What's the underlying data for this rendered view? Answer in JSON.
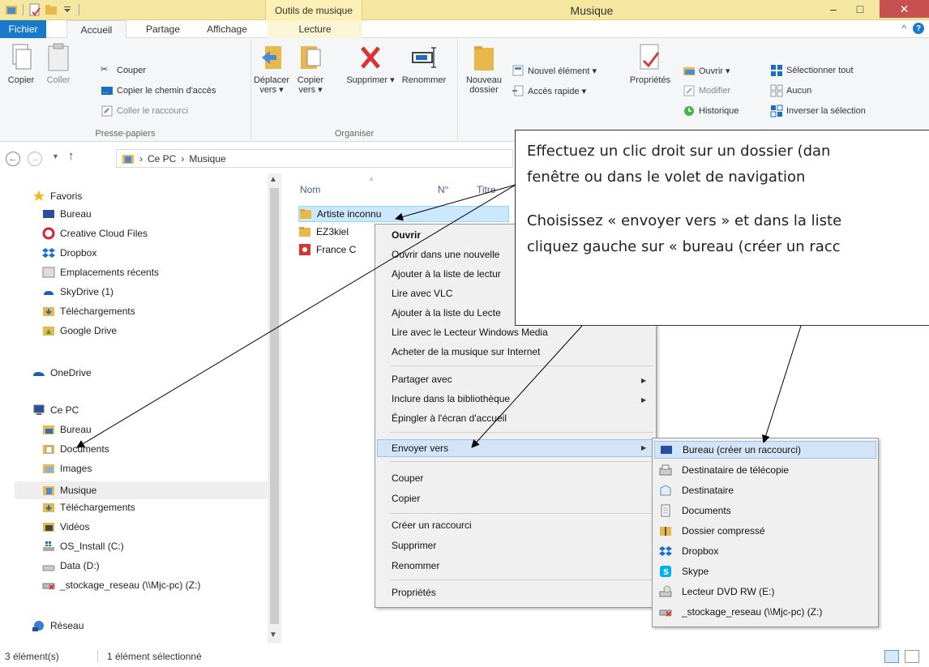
{
  "window": {
    "title": "Musique",
    "contextual_tab_group": "Outils de musique",
    "controls": {
      "minimize": "–",
      "maximize": "□",
      "close": "✕"
    }
  },
  "tabs": {
    "file": "Fichier",
    "home": "Accueil",
    "share": "Partage",
    "view": "Affichage",
    "play": "Lecture"
  },
  "ribbon": {
    "clipboard": {
      "label": "Presse-papiers",
      "copy": "Copier",
      "paste": "Coller",
      "cut": "Couper",
      "copy_path": "Copier le chemin d'accès",
      "paste_shortcut": "Coller le raccourci"
    },
    "organize": {
      "label": "Organiser",
      "move_to": "Déplacer vers ▾",
      "copy_to": "Copier vers ▾",
      "delete": "Supprimer ▾",
      "rename": "Renommer"
    },
    "new": {
      "new_folder": "Nouveau dossier",
      "new_item": "Nouvel élément ▾",
      "easy_access": "Accès rapide ▾"
    },
    "open": {
      "properties": "Propriétés",
      "open": "Ouvrir ▾",
      "edit": "Modifier",
      "history": "Historique"
    },
    "select": {
      "select_all": "Sélectionner tout",
      "select_none": "Aucun",
      "invert": "Inverser la sélection"
    }
  },
  "address": {
    "path": [
      "Ce PC",
      "Musique"
    ],
    "separator": "›"
  },
  "nav": {
    "favorites": "Favoris",
    "favorites_items": [
      "Bureau",
      "Creative Cloud Files",
      "Dropbox",
      "Emplacements récents",
      "SkyDrive (1)",
      "Téléchargements",
      "Google Drive"
    ],
    "onedrive": "OneDrive",
    "thispc": "Ce PC",
    "thispc_items": [
      "Bureau",
      "Documents",
      "Images",
      "Musique",
      "Téléchargements",
      "Vidéos",
      "OS_Install (C:)",
      "Data (D:)",
      "_stockage_reseau (\\\\Mjc-pc) (Z:)"
    ],
    "network": "Réseau"
  },
  "columns": {
    "name": "Nom",
    "number": "N°",
    "title": "Titre"
  },
  "files": [
    "Artiste inconnu",
    "EZ3kiel",
    "France C"
  ],
  "context_menu": {
    "open": "Ouvrir",
    "open_new": "Ouvrir dans une nouvelle",
    "add_playlist": "Ajouter à la liste de lectur",
    "play_vlc": "Lire avec VLC",
    "add_player_list": "Ajouter à la liste du Lecte",
    "play_wmp": "Lire avec le Lecteur Windows Media",
    "buy_music": "Acheter de la musique sur Internet",
    "share_with": "Partager avec",
    "include_library": "Inclure dans la bibliothèque",
    "pin_start": "Épingler à l'écran d'accueil",
    "send_to": "Envoyer vers",
    "cut": "Couper",
    "copy": "Copier",
    "create_shortcut": "Créer un raccourci",
    "delete": "Supprimer",
    "rename": "Renommer",
    "properties": "Propriétés",
    "submenu_arrow": "▶"
  },
  "send_to_menu": {
    "desktop": "Bureau (créer un raccourci)",
    "fax": "Destinataire de télécopie",
    "mail": "Destinataire",
    "documents": "Documents",
    "zip": "Dossier compressé",
    "dropbox": "Dropbox",
    "skype": "Skype",
    "dvd": "Lecteur DVD RW (E:)",
    "network": "_stockage_reseau (\\\\Mjc-pc) (Z:)"
  },
  "callout": {
    "line1": "Effectuez un clic droit sur un dossier (dan",
    "line2": "fenêtre ou dans le volet de navigation",
    "line3": "Choisissez « envoyer vers » et dans la liste",
    "line4": "cliquez gauche sur « bureau (créer un racc"
  },
  "status": {
    "count": "3 élément(s)",
    "selected": "1 élément sélectionné"
  },
  "colors": {
    "file_tab": "#1979ca",
    "title_bar": "#f6e7a0",
    "selection": "#cce8ff",
    "menu_highlight": "#d4e4f7",
    "close_button": "#c75050"
  }
}
